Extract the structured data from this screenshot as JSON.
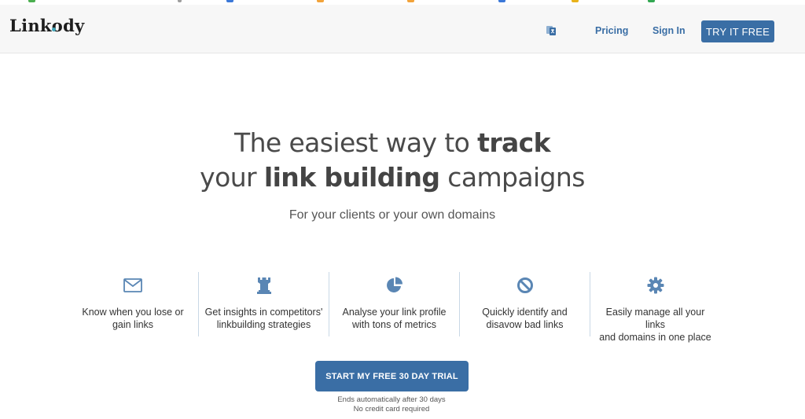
{
  "colors": {
    "accent": "#3a6ea5",
    "icon": "#5a86b4",
    "divider": "#c9d8e6",
    "header_bg": "#f7f7f7"
  },
  "header": {
    "logo": "Linkody",
    "language_icon": "translate-icon",
    "nav": {
      "pricing": "Pricing",
      "sign_in": "Sign In"
    },
    "try_button": "TRY IT FREE"
  },
  "hero": {
    "line1_pre": "The easiest way to ",
    "line1_bold": "track",
    "line2_pre": "your ",
    "line2_bold": "link building",
    "line2_post": " campaigns",
    "subtitle": "For your clients or your own domains"
  },
  "features": [
    {
      "icon": "envelope-icon",
      "line1": "Know when you lose or",
      "line2": "gain links"
    },
    {
      "icon": "rook-icon",
      "line1": "Get insights in competitors'",
      "line2": "linkbuilding strategies"
    },
    {
      "icon": "pie-chart-icon",
      "line1": "Analyse your link profile",
      "line2": "with tons of metrics"
    },
    {
      "icon": "ban-icon",
      "line1": "Quickly identify and",
      "line2": "disavow bad links"
    },
    {
      "icon": "gear-icon",
      "line1": "Easily manage all your links",
      "line2": "and domains in one place"
    }
  ],
  "cta": {
    "button": "START MY FREE 30 DAY TRIAL",
    "note1": "Ends automatically after 30 days",
    "note2": "No credit card required"
  }
}
